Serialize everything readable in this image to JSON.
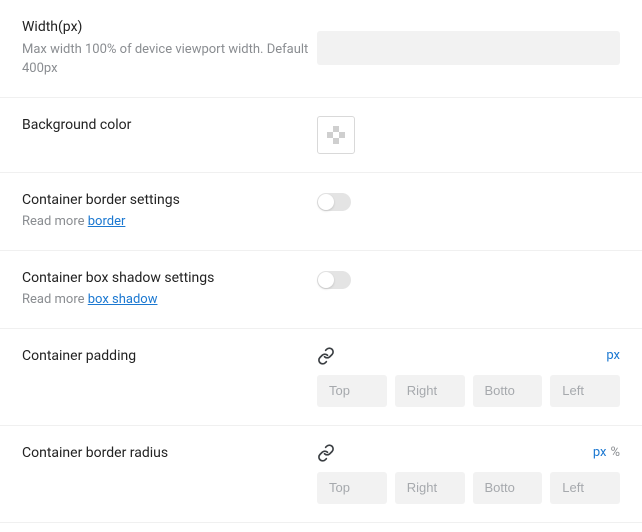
{
  "width": {
    "label": "Width(px)",
    "hint": "Max width 100% of device viewport width. Default 400px",
    "value": ""
  },
  "bgcolor": {
    "label": "Background color"
  },
  "border": {
    "label": "Container border settings",
    "hint_prefix": "Read more ",
    "hint_link": "border",
    "on": false
  },
  "boxshadow": {
    "label": "Container box shadow settings",
    "hint_prefix": "Read more ",
    "hint_link": "box shadow",
    "on": false
  },
  "padding": {
    "label": "Container padding",
    "units": {
      "px": "px"
    },
    "placeholders": {
      "top": "Top",
      "right": "Right",
      "bottom": "Botto",
      "left": "Left"
    }
  },
  "radius": {
    "label": "Container border radius",
    "units": {
      "px": "px",
      "pct": "%"
    },
    "placeholders": {
      "top": "Top",
      "right": "Right",
      "bottom": "Botto",
      "left": "Left"
    }
  }
}
